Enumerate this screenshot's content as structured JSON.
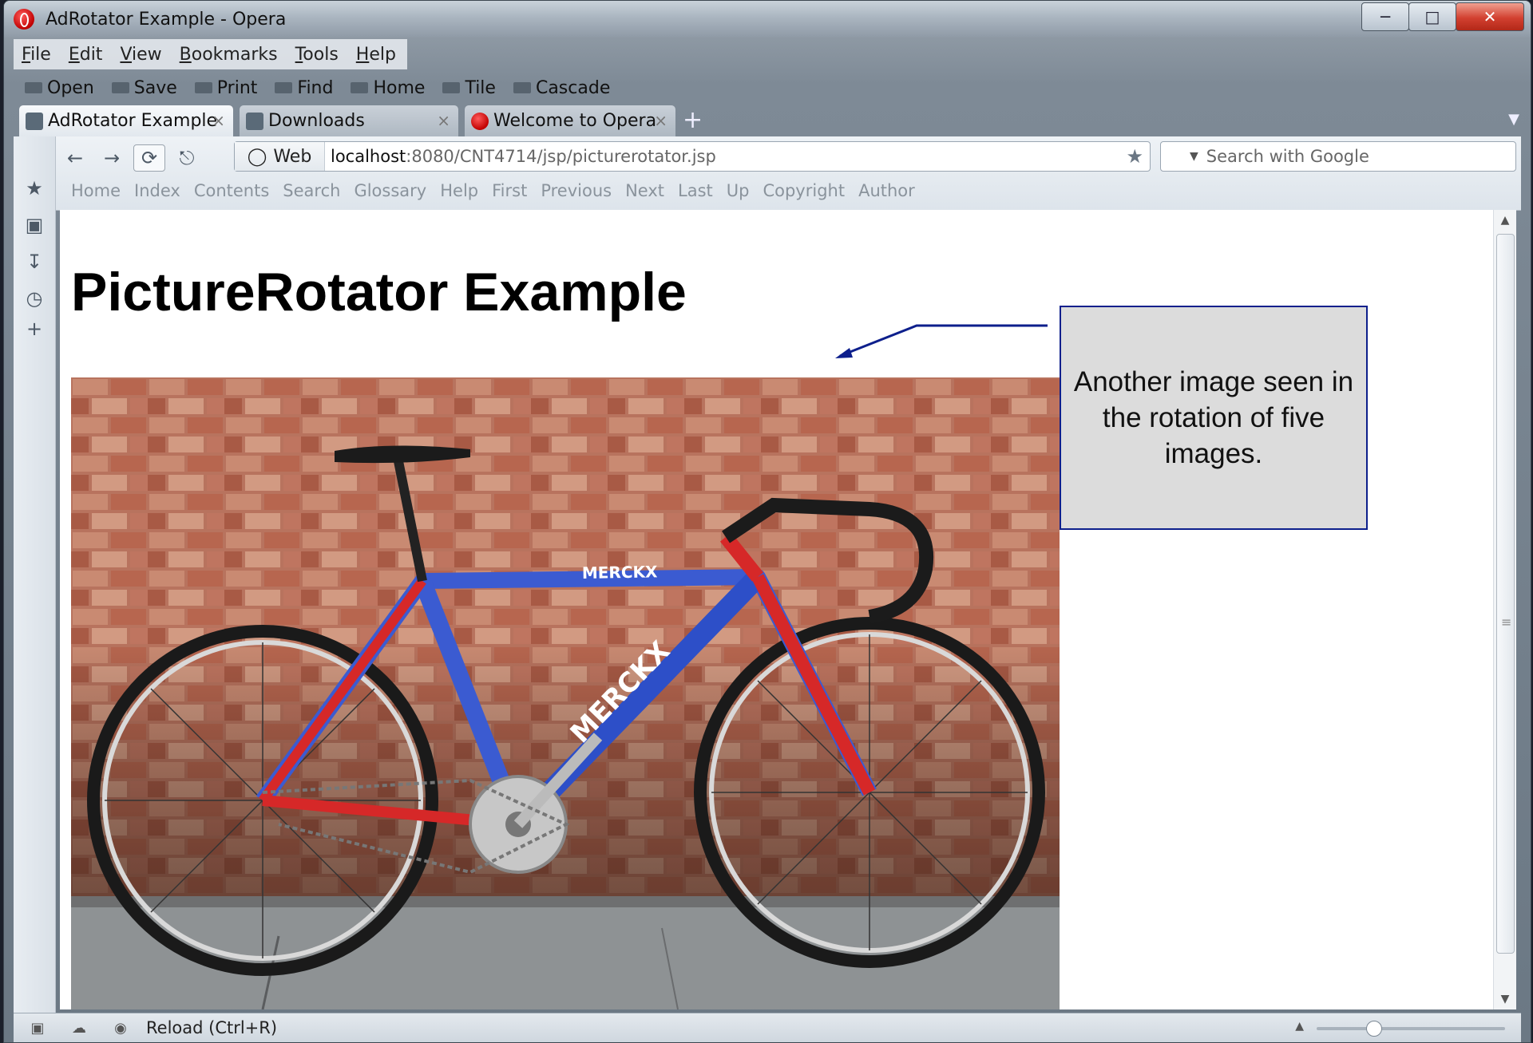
{
  "window": {
    "title": "AdRotator Example - Opera",
    "controls": [
      "minimize-icon",
      "maximize-icon",
      "close-icon"
    ]
  },
  "menu": [
    {
      "label": "File",
      "key": "F",
      "rest": "ile"
    },
    {
      "label": "Edit",
      "key": "E",
      "rest": "dit"
    },
    {
      "label": "View",
      "key": "V",
      "rest": "iew"
    },
    {
      "label": "Bookmarks",
      "key": "B",
      "rest": "ookmarks"
    },
    {
      "label": "Tools",
      "key": "T",
      "rest": "ools"
    },
    {
      "label": "Help",
      "key": "H",
      "rest": "elp"
    }
  ],
  "toolbar": {
    "open": "Open",
    "save": "Save",
    "print": "Print",
    "find": "Find",
    "home": "Home",
    "tile": "Tile",
    "cascade": "Cascade"
  },
  "tabs": [
    {
      "label": "AdRotator Example",
      "active": true
    },
    {
      "label": "Downloads",
      "active": false
    },
    {
      "label": "Welcome to Opera",
      "active": false
    }
  ],
  "address": {
    "scheme_label": "Web",
    "host": "localhost",
    "path": ":8080/CNT4714/jsp/picturerotator.jsp"
  },
  "search": {
    "placeholder": "Search with Google"
  },
  "linkbar": [
    "Home",
    "Index",
    "Contents",
    "Search",
    "Glossary",
    "Help",
    "First",
    "Previous",
    "Next",
    "Last",
    "Up",
    "Copyright",
    "Author"
  ],
  "page": {
    "title": "PictureRotator Example"
  },
  "callout": {
    "text": "Another image seen in the rotation of five images."
  },
  "status": {
    "text": "Reload (Ctrl+R)",
    "zoom_fraction": 0.3
  },
  "colors": {
    "callout_border": "#0d1f8c",
    "callout_fill": "#dcdcdc",
    "arrow": "#0d1f8c"
  }
}
